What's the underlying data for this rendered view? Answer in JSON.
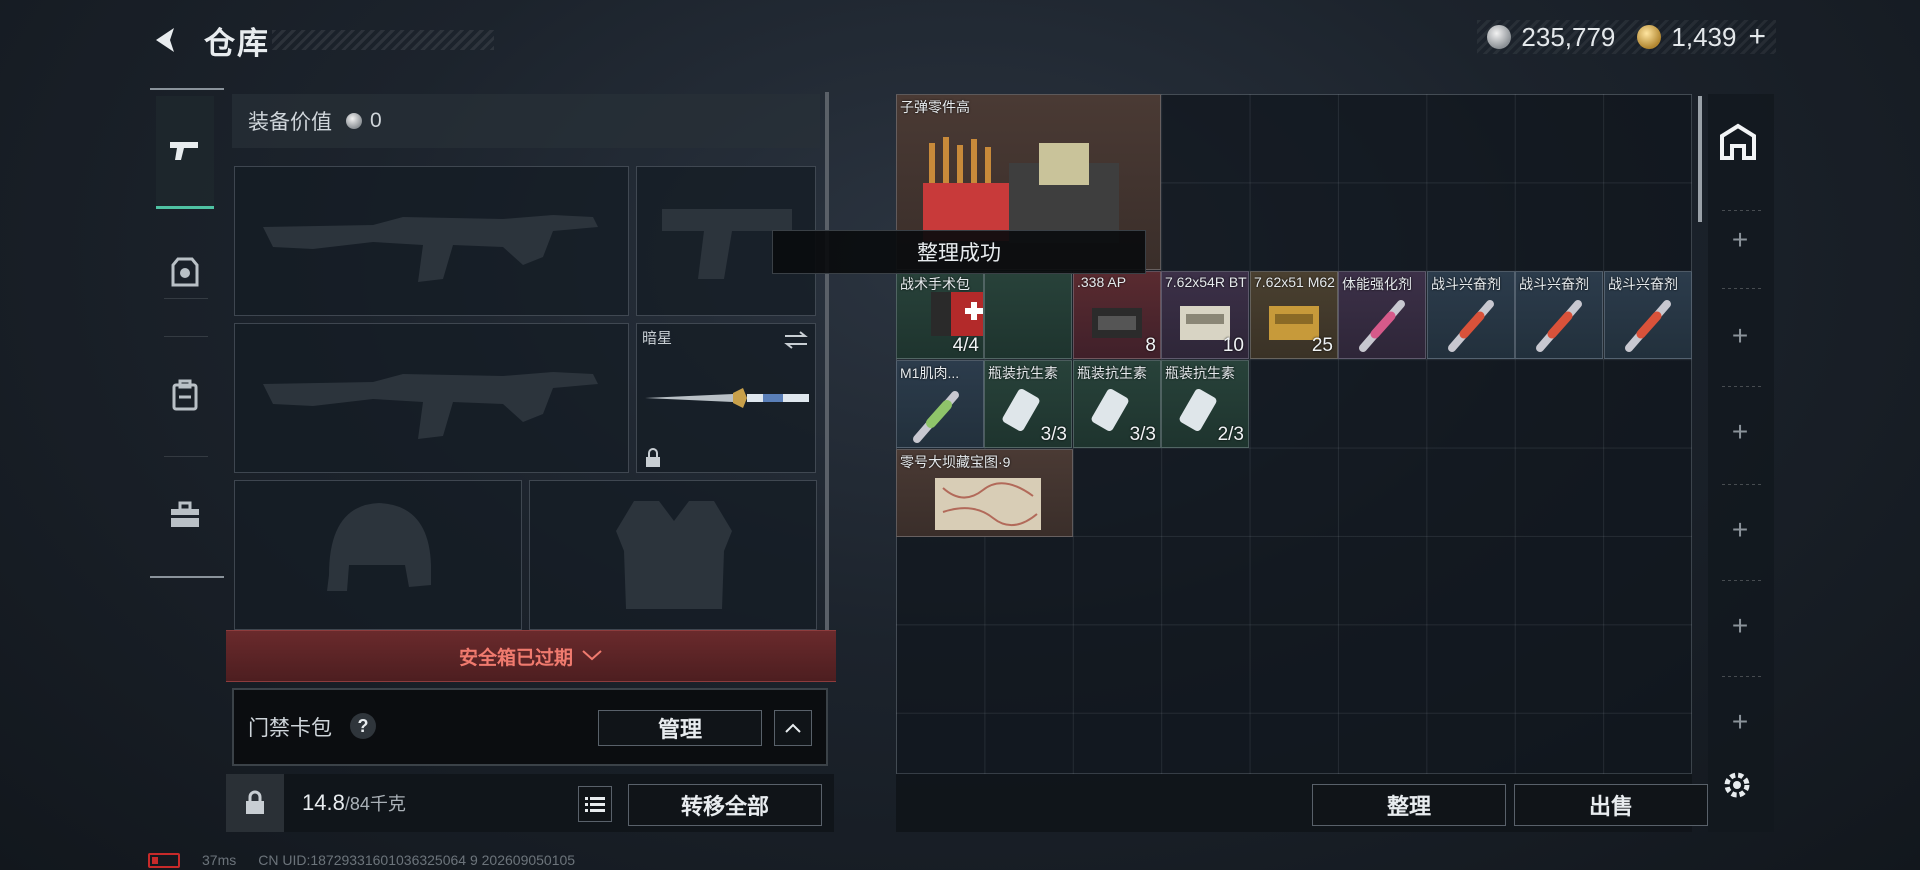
{
  "header": {
    "title": "仓库",
    "currency_silver": "235,779",
    "currency_gold": "1,439",
    "add_label": "+"
  },
  "equipment": {
    "value_label": "装备价值",
    "value": "0",
    "melee_name": "暗星",
    "safebox_status": "安全箱已过期",
    "keycard_label": "门禁卡包",
    "help": "?",
    "manage_button": "管理",
    "weight_current": "14.8",
    "weight_max": "/84千克",
    "transfer_all_button": "转移全部"
  },
  "grid": {
    "toast": "整理成功",
    "items": [
      {
        "name": "子弹零件高",
        "count": ""
      },
      {
        "name": "战术手术包",
        "count": "4/4"
      },
      {
        "name": ".338 AP",
        "count": "8"
      },
      {
        "name": "7.62x54R BT",
        "count": "10"
      },
      {
        "name": "7.62x51 M62",
        "count": "25"
      },
      {
        "name": "体能强化剂",
        "count": ""
      },
      {
        "name": "战斗兴奋剂",
        "count": ""
      },
      {
        "name": "战斗兴奋剂",
        "count": ""
      },
      {
        "name": "战斗兴奋剂",
        "count": ""
      },
      {
        "name": "M1肌肉...",
        "count": ""
      },
      {
        "name": "瓶装抗生素",
        "count": "3/3"
      },
      {
        "name": "瓶装抗生素",
        "count": "3/3"
      },
      {
        "name": "瓶装抗生素",
        "count": "2/3"
      },
      {
        "name": "零号大坝藏宝图·9",
        "count": ""
      }
    ],
    "organize_button": "整理",
    "sell_button": "出售"
  },
  "status": {
    "ping": "37ms",
    "uid": "CN UID:18729331601036325064 9 202609050105"
  },
  "colors": {
    "accent": "#4fc2a3",
    "danger": "#f07a6e",
    "currency_gold": "#d8a84a"
  }
}
